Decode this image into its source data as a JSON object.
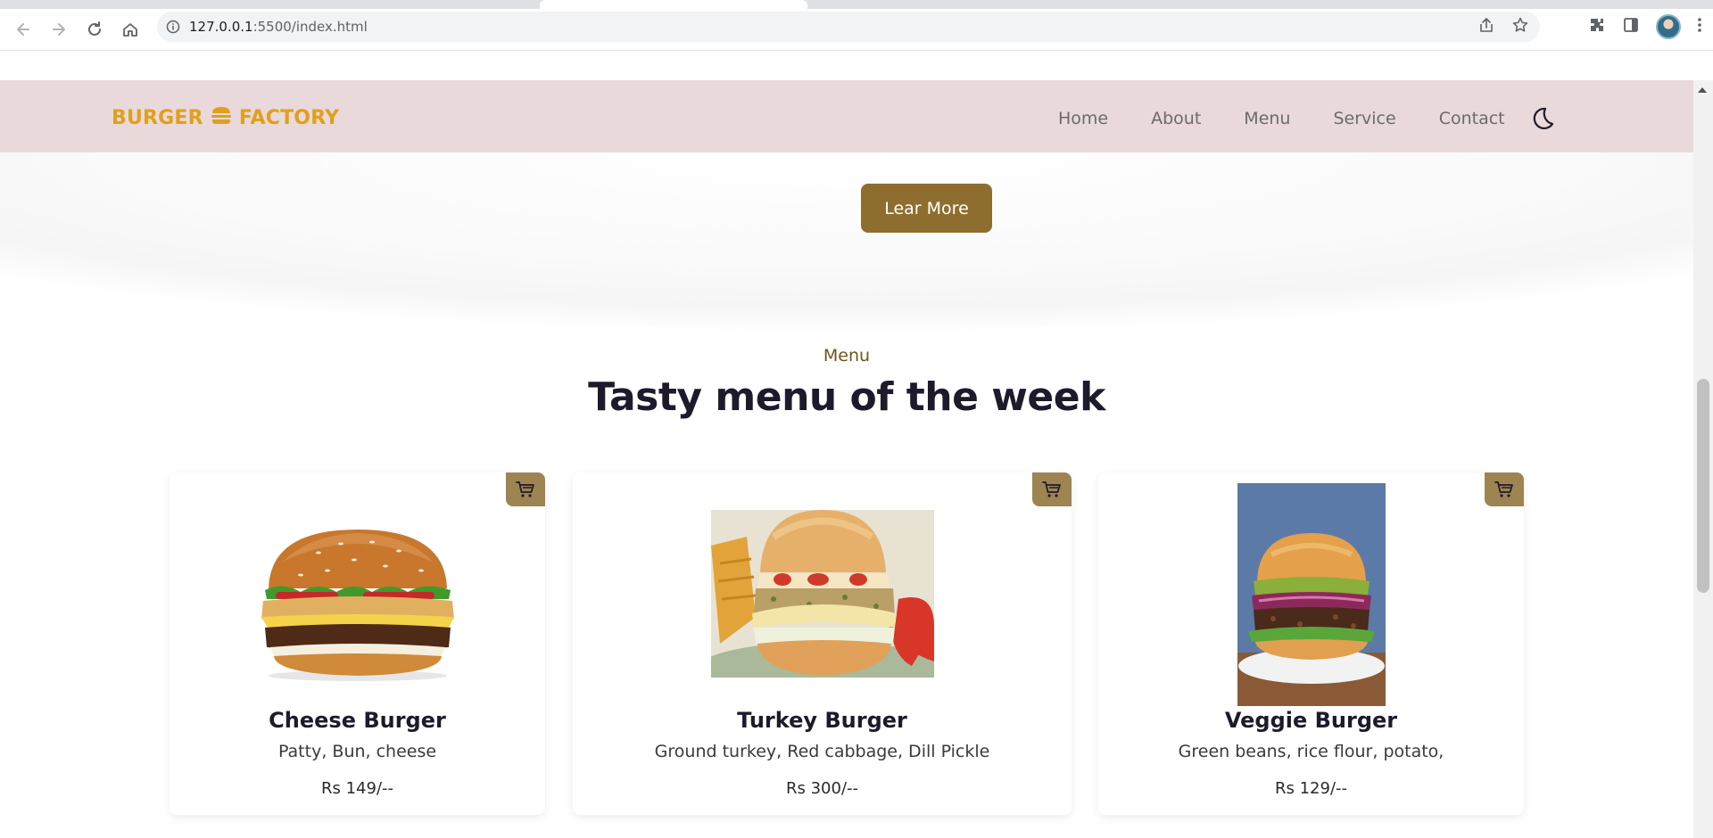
{
  "browser": {
    "url_host": "127.0.0.1",
    "url_rest": ":5500/index.html"
  },
  "header": {
    "logo_left": "BURGER",
    "logo_right": "FACTORY",
    "nav": [
      "Home",
      "About",
      "Menu",
      "Service",
      "Contact"
    ]
  },
  "hero": {
    "button_label": "Lear More"
  },
  "menu": {
    "subtitle": "Menu",
    "title": "Tasty menu of the week",
    "items": [
      {
        "name": "Cheese Burger",
        "desc": "Patty, Bun, cheese",
        "price": "Rs 149/--"
      },
      {
        "name": "Turkey Burger",
        "desc": "Ground turkey, Red cabbage, Dill Pickle",
        "price": "Rs 300/--"
      },
      {
        "name": "Veggie Burger",
        "desc": "Green beans, rice flour, potato,",
        "price": "Rs 129/--"
      }
    ]
  },
  "colors": {
    "header_bg": "#ead9da",
    "logo": "#e0a01c",
    "button": "#8d6e2e",
    "cart": "#9d8451"
  },
  "icons": [
    "back-icon",
    "forward-icon",
    "reload-icon",
    "home-icon",
    "info-icon",
    "share-icon",
    "star-icon",
    "extensions-icon",
    "side-panel-icon",
    "menu-dots-icon",
    "burger-icon",
    "moon-icon",
    "cart-icon"
  ]
}
